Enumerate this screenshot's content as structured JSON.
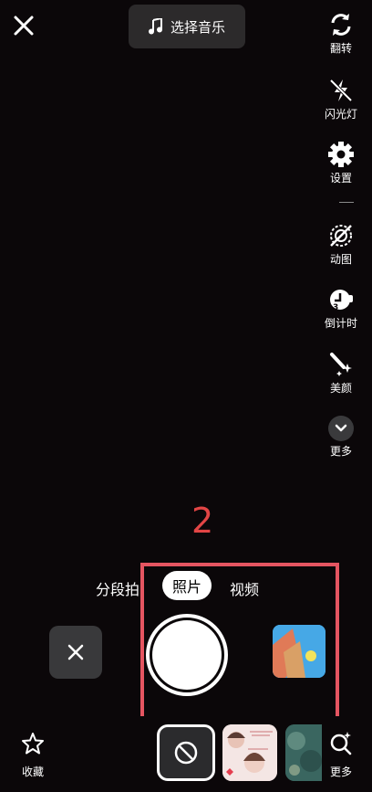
{
  "top": {
    "music_label": "选择音乐"
  },
  "sidebar": {
    "items": [
      {
        "label": "翻转",
        "icon": "flip-camera-icon"
      },
      {
        "label": "闪光灯",
        "icon": "flash-off-icon"
      },
      {
        "label": "设置",
        "icon": "gear-icon"
      },
      {
        "label": "动图",
        "icon": "gif-icon"
      },
      {
        "label": "倒计时",
        "icon": "timer-icon"
      },
      {
        "label": "美颜",
        "icon": "beauty-wand-icon"
      },
      {
        "label": "更多",
        "icon": "chevron-down-icon"
      }
    ]
  },
  "annotation": {
    "number": "2",
    "color": "#e24545"
  },
  "modes": {
    "segment": "分段拍",
    "photo": "照片",
    "video": "视频",
    "selected": "照片"
  },
  "bottom": {
    "favorites_label": "收藏",
    "more_label": "更多"
  },
  "colors": {
    "highlight_box": "#e55561",
    "background": "#0b0709"
  }
}
